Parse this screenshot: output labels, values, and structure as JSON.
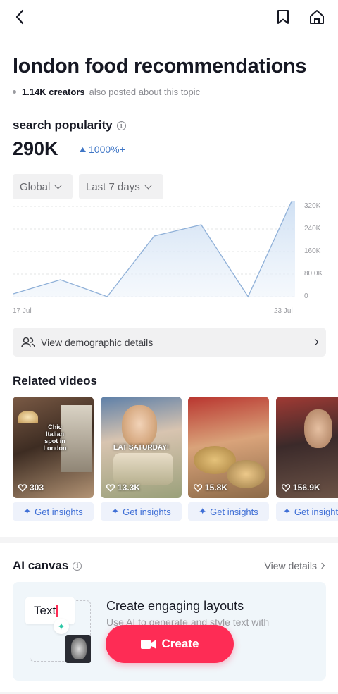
{
  "topic": {
    "title": "london food recommendations",
    "creators_count": "1.14K creators",
    "creators_suffix": "also posted about this topic"
  },
  "popularity": {
    "label": "search popularity",
    "value": "290K",
    "growth": "1000%+",
    "colors": {
      "growth": "#3f76c6",
      "line": "#8fb0d8"
    }
  },
  "filters": {
    "region": "Global",
    "period": "Last 7 days"
  },
  "chart_data": {
    "type": "area",
    "x": [
      "17 Jul",
      "18 Jul",
      "19 Jul",
      "20 Jul",
      "21 Jul",
      "22 Jul",
      "23 Jul"
    ],
    "series": [
      {
        "values": [
          10000,
          60000,
          0,
          215000,
          255000,
          0,
          365000
        ]
      }
    ],
    "ylim": [
      0,
      320000
    ],
    "y_ticks": [
      "320K",
      "240K",
      "160K",
      "80.0K",
      "0"
    ],
    "x_tick_labels": [
      "17 Jul",
      "23 Jul"
    ],
    "grid": true,
    "title": "",
    "xlabel": "",
    "ylabel": ""
  },
  "demographic_button": "View demographic details",
  "related": {
    "title": "Related videos",
    "insight_label": "Get insights",
    "videos": [
      {
        "likes": "303",
        "overlay": "Chic Italian spot in London"
      },
      {
        "likes": "13.3K",
        "overlay": "EAT SATURDAY!"
      },
      {
        "likes": "15.8K",
        "overlay": ""
      },
      {
        "likes": "156.9K",
        "overlay": ""
      }
    ]
  },
  "ai_canvas": {
    "title": "AI canvas",
    "view_details": "View details",
    "sample_text": "Text",
    "heading": "Create engaging layouts",
    "description": "Use AI to generate and style text with"
  },
  "create_button": "Create",
  "accent_color": "#fe2c55",
  "icons": [
    "back-arrow-icon",
    "bookmark-icon",
    "home-icon",
    "info-icon",
    "people-icon",
    "heart-icon",
    "sparkle-icon",
    "video-camera-icon"
  ]
}
